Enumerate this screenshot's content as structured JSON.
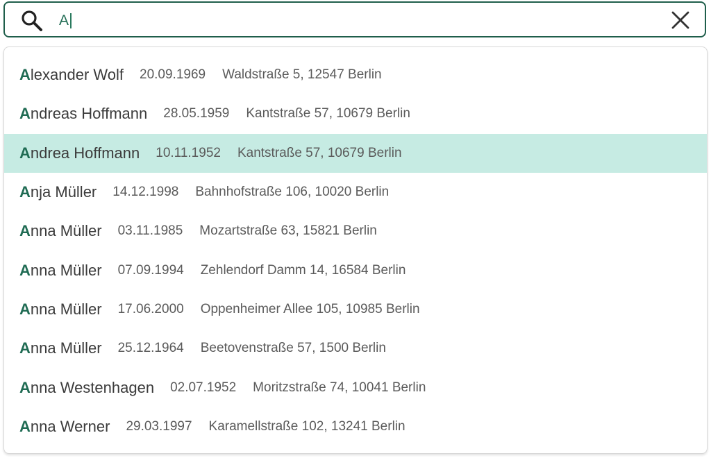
{
  "search": {
    "value": "A"
  },
  "colors": {
    "accent": "#1f6b53",
    "highlight": "#c6ebe3",
    "border": "#1f5e4b"
  },
  "icons": {
    "search": "search-icon",
    "clear": "close-icon"
  },
  "results": [
    {
      "match": "A",
      "rest": "lexander Wolf",
      "dob": "20.09.1969",
      "address": "Waldstraße 5, 12547 Berlin",
      "highlighted": false
    },
    {
      "match": "A",
      "rest": "ndreas Hoffmann",
      "dob": "28.05.1959",
      "address": "Kantstraße 57, 10679 Berlin",
      "highlighted": false
    },
    {
      "match": "A",
      "rest": "ndrea Hoffmann",
      "dob": "10.11.1952",
      "address": "Kantstraße 57, 10679 Berlin",
      "highlighted": true
    },
    {
      "match": "A",
      "rest": "nja Müller",
      "dob": "14.12.1998",
      "address": "Bahnhofstraße 106, 10020 Berlin",
      "highlighted": false
    },
    {
      "match": "A",
      "rest": "nna Müller",
      "dob": "03.11.1985",
      "address": "Mozartstraße 63, 15821 Berlin",
      "highlighted": false
    },
    {
      "match": "A",
      "rest": "nna Müller",
      "dob": "07.09.1994",
      "address": "Zehlendorf Damm 14, 16584 Berlin",
      "highlighted": false
    },
    {
      "match": "A",
      "rest": "nna Müller",
      "dob": "17.06.2000",
      "address": "Oppenheimer Allee 105, 10985 Berlin",
      "highlighted": false
    },
    {
      "match": "A",
      "rest": "nna Müller",
      "dob": "25.12.1964",
      "address": "Beetovenstraße 57, 1500 Berlin",
      "highlighted": false
    },
    {
      "match": "A",
      "rest": "nna Westenhagen",
      "dob": "02.07.1952",
      "address": "Moritzstraße 74, 10041 Berlin",
      "highlighted": false
    },
    {
      "match": "A",
      "rest": "nna Werner",
      "dob": "29.03.1997",
      "address": "Karamellstraße 102, 13241 Berlin",
      "highlighted": false
    }
  ]
}
